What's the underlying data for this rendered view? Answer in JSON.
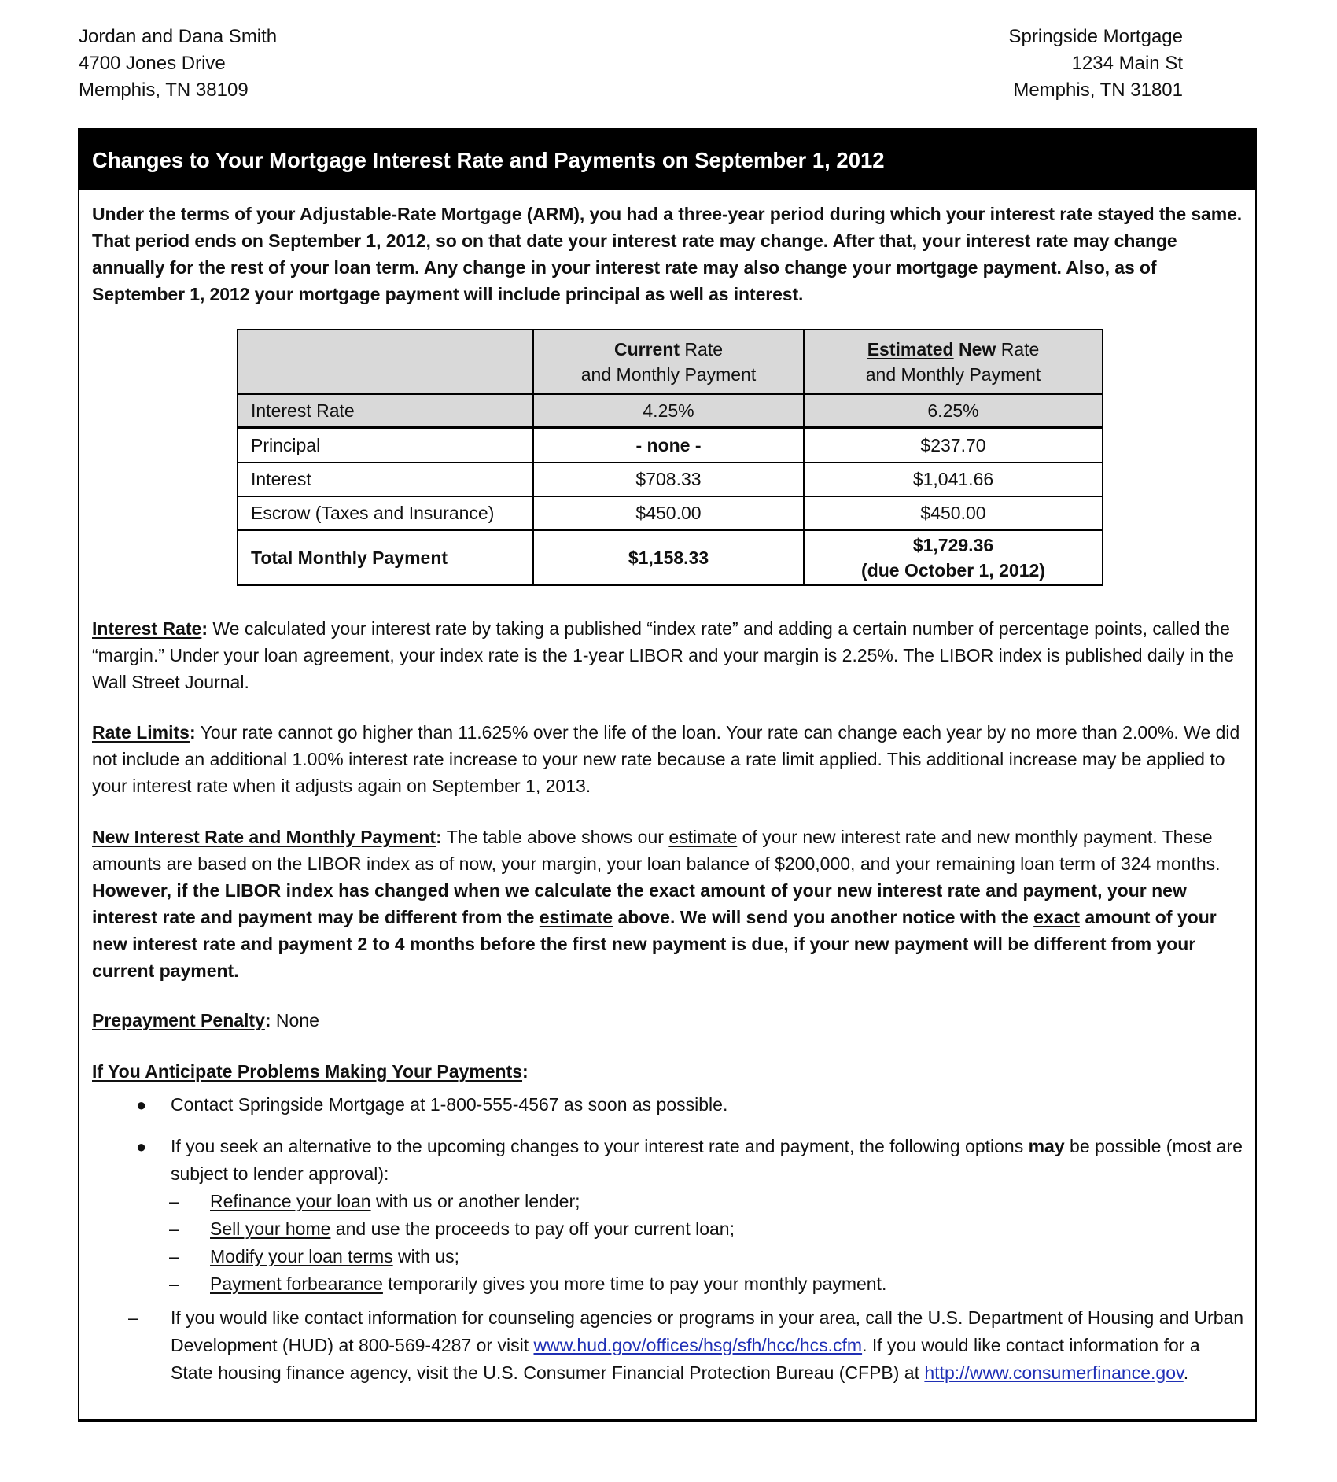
{
  "recipient": {
    "name": "Jordan and Dana Smith",
    "street": "4700 Jones Drive",
    "city": "Memphis, TN 38109"
  },
  "sender": {
    "name": "Springside Mortgage",
    "street": "1234 Main St",
    "city": "Memphis, TN 31801"
  },
  "banner_title": "Changes to Your Mortgage Interest Rate and Payments on September 1, 2012",
  "intro": "Under the terms of your Adjustable-Rate Mortgage (ARM), you had a three-year period during which your interest rate stayed the same. That period ends on September 1, 2012, so on that date your interest rate may change.  After that, your interest rate may change annually for the rest of your loan term. Any change in your interest rate may also change your mortgage payment. Also, as of September 1, 2012 your mortgage payment will include principal as well as interest.",
  "table": {
    "col_current": {
      "bold": "Current",
      "rest": " Rate",
      "line2": "and Monthly Payment"
    },
    "col_new": {
      "underlined": "Estimated",
      "bold": " New",
      "rest": " Rate",
      "line2": "and Monthly Payment"
    },
    "rows": [
      {
        "label": "Interest Rate",
        "current": "4.25%",
        "new": "6.25%"
      },
      {
        "label": "Principal",
        "current": "- none -",
        "new": "$237.70"
      },
      {
        "label": "Interest",
        "current": "$708.33",
        "new": "$1,041.66"
      },
      {
        "label": "Escrow (Taxes and Insurance)",
        "current": "$450.00",
        "new": "$450.00"
      }
    ],
    "total": {
      "label": "Total Monthly Payment",
      "current": "$1,158.33",
      "new": "$1,729.36",
      "new_note": "(due October 1, 2012)"
    }
  },
  "interest_rate": {
    "heading": "Interest Rate",
    "text": " We calculated your interest rate by taking a published “index rate” and adding a certain number of percentage points, called the “margin.” Under your loan agreement, your index rate is the 1-year LIBOR and your margin is 2.25%. The LIBOR index is published daily in the Wall Street Journal."
  },
  "rate_limits": {
    "heading": "Rate Limits",
    "text": " Your rate cannot go higher than 11.625% over the life of the loan. Your rate can change each year by no more than 2.00%. We did not include an additional 1.00% interest rate increase to your new rate because a rate limit applied. This additional increase may be applied to your interest rate when it adjusts again on September 1, 2013."
  },
  "new_rate": {
    "heading": "New Interest Rate and Monthly Payment",
    "t1": " The table above shows our ",
    "u1": "estimate",
    "t2": " of your new interest rate and new monthly payment. These amounts are based on the LIBOR index as of now, your margin, your loan balance of $200,000, and your remaining loan term of 324 months. ",
    "b1": "However, if the LIBOR index has changed when we calculate the exact amount of your new interest rate and payment, your new interest rate and payment may be different from the ",
    "bu1": "estimate",
    "b2": " above. We will send you another notice with the ",
    "bu2": "exact",
    "b3": " amount of your new interest rate and payment 2 to 4 months before the first new payment is due, if your new payment will be different from your current payment."
  },
  "prepayment": {
    "heading": "Prepayment Penalty",
    "value": " None"
  },
  "problems": {
    "heading": "If You Anticipate Problems Making Your Payments",
    "bullet1": " Contact Springside Mortgage at 1-800-555-4567 as soon as possible.",
    "bullet2_pre": "If you seek an alternative to the upcoming changes to your interest rate and payment, the following options ",
    "bullet2_bold": "may",
    "bullet2_post": " be possible (most are subject to lender approval):",
    "options": [
      {
        "link": "Refinance your loan",
        "rest": " with us or another lender;"
      },
      {
        "link": "Sell your home",
        "rest": " and use the proceeds to pay off your current loan;"
      },
      {
        "link": "Modify your loan terms",
        "rest": " with us;"
      },
      {
        "link": "Payment forbearance",
        "rest": " temporarily gives you more time to pay your monthly payment."
      }
    ],
    "counseling_pre": "If you would like contact information for counseling agencies or programs in your area, call the U.S. Department of Housing and Urban Development (HUD) at 800-569-4287 or visit ",
    "hud_link": "www.hud.gov/offices/hsg/sfh/hcc/hcs.cfm",
    "counseling_mid": ". If you would like contact information for a State housing finance agency, visit the U.S. Consumer Financial Protection Bureau (CFPB) at ",
    "cfpb_link": "http://www.consumerfinance.gov",
    "counseling_end": "."
  },
  "colors": {
    "link": "#1f2fb5",
    "banner_bg": "#000000",
    "table_shade": "#d9d9d9"
  }
}
